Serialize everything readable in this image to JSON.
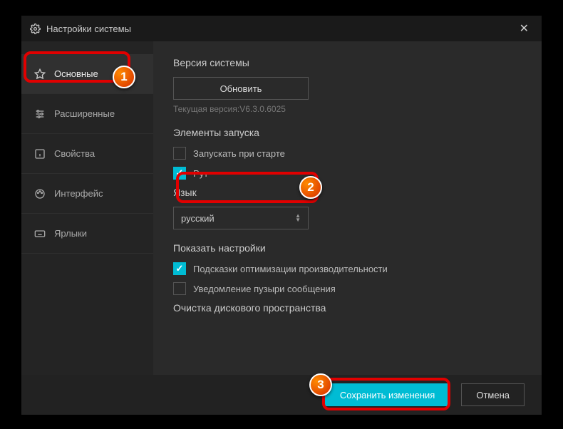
{
  "window": {
    "title": "Настройки системы"
  },
  "sidebar": {
    "items": [
      {
        "label": "Основные"
      },
      {
        "label": "Ярлыки"
      },
      {
        "label": "Свойства"
      },
      {
        "label": "Интерфейс"
      },
      {
        "label": "Расширенные"
      }
    ]
  },
  "sections": {
    "version": {
      "title": "Версия системы",
      "update_btn": "Обновить",
      "current": "Текущая версия:V6.3.0.6025"
    },
    "startup": {
      "title": "Элементы запуска",
      "launch_on_start": "Запускать при старте",
      "root": "Рут"
    },
    "lang": {
      "title": "Язык",
      "value": "русский"
    },
    "show": {
      "title": "Показать настройки",
      "perf_tips": "Подсказки оптимизации производительности",
      "bubble": "Уведомление пузыри сообщения"
    },
    "cleanup": {
      "title": "Очистка дискового пространства"
    }
  },
  "footer": {
    "save": "Сохранить изменения",
    "cancel": "Отмена"
  },
  "badges": {
    "b1": "1",
    "b2": "2",
    "b3": "3"
  }
}
